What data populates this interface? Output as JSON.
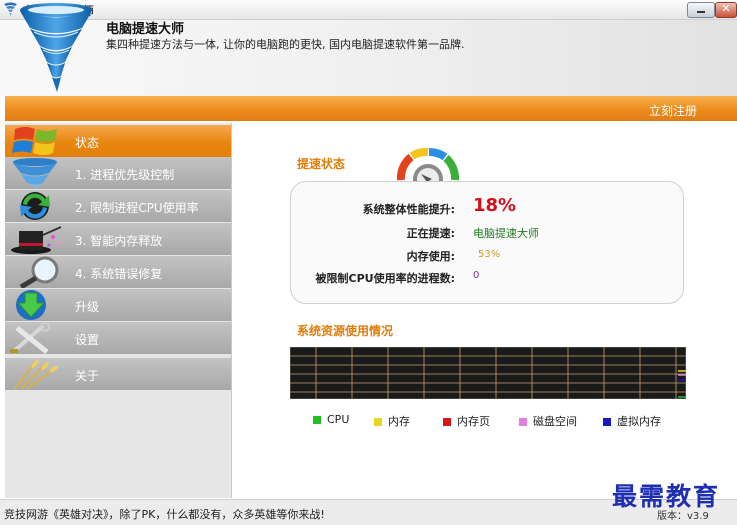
{
  "window": {
    "title": "电脑提速大师",
    "minimize_icon": "minimize-icon",
    "close_icon": "close-icon",
    "close_glyph": "✕"
  },
  "header": {
    "app_name": "电脑提速大师",
    "slogan": "集四种提速方法与一体, 让你的电脑跑的更快, 国内电脑提速软件第一品牌.",
    "logo_icon": "tornado-logo"
  },
  "orange_bar": {
    "register_label": "立刻注册",
    "color": "#ec8b1d"
  },
  "sidebar": {
    "items": [
      {
        "label": "状态",
        "icon": "windows-flag-icon",
        "active": true
      },
      {
        "label": "1. 进程优先级控制",
        "icon": "tornado-icon",
        "active": false
      },
      {
        "label": "2. 限制进程CPU使用率",
        "icon": "refresh-arrows-icon",
        "active": false
      },
      {
        "label": "3. 智能内存释放",
        "icon": "magic-hat-icon",
        "active": false
      },
      {
        "label": "4. 系统错误修复",
        "icon": "magnifier-icon",
        "active": false
      },
      {
        "label": "升级",
        "icon": "download-arrow-icon",
        "active": false
      },
      {
        "label": "设置",
        "icon": "tools-icon",
        "active": false
      },
      {
        "label": "关于",
        "icon": "wheat-icon",
        "active": false
      }
    ]
  },
  "status": {
    "section_title": "提速状态",
    "gauge_icon": "gauge-icon",
    "rows": {
      "perf_label": "系统整体性能提升:",
      "perf_value": "18%",
      "accel_label": "正在提速:",
      "accel_value": "电脑提速大师",
      "mem_label": "内存使用:",
      "mem_value": "53%",
      "proc_label": "被限制CPU使用率的进程数:",
      "proc_value": "0"
    }
  },
  "resources": {
    "section_title": "系统资源使用情况",
    "graph_name": "resource-usage-graph",
    "legend": [
      {
        "label": "CPU",
        "color": "#22c022"
      },
      {
        "label": "内存",
        "color": "#e8d820"
      },
      {
        "label": "内存页",
        "color": "#d81818"
      },
      {
        "label": "磁盘空间",
        "color": "#e080e0"
      },
      {
        "label": "虚拟内存",
        "color": "#1818c8"
      }
    ]
  },
  "status_bar": {
    "ad_text": "竞技网游《英雄对决》，除了PK，什么都没有，众多英雄等你来战!",
    "version": "版本：v3.9"
  },
  "watermark": "最需教育"
}
